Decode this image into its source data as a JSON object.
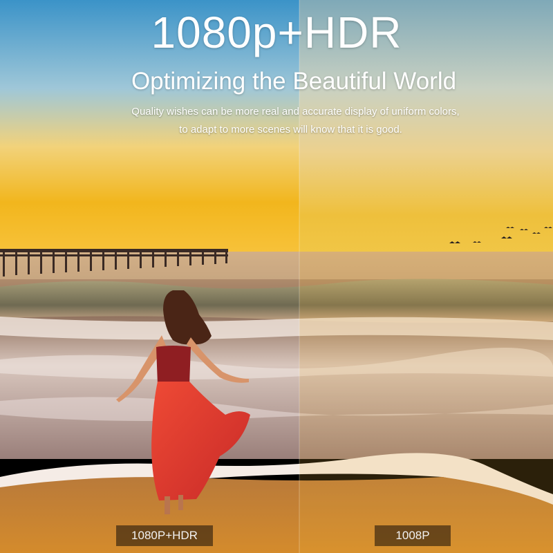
{
  "headline": "1080p+HDR",
  "subheadline": "Optimizing the Beautiful World",
  "description": [
    "Quality wishes can be more real and accurate display of uniform colors,",
    "to adapt to more scenes will know that it is good."
  ],
  "labels": {
    "left": "1080P+HDR",
    "right": "1008P"
  },
  "colors": {
    "sky_top": "#3b93c8",
    "sunset_gold": "#f2b61d",
    "sea": "#8b6a55",
    "sand": "#c07a2e",
    "dress": "#e0392c"
  }
}
